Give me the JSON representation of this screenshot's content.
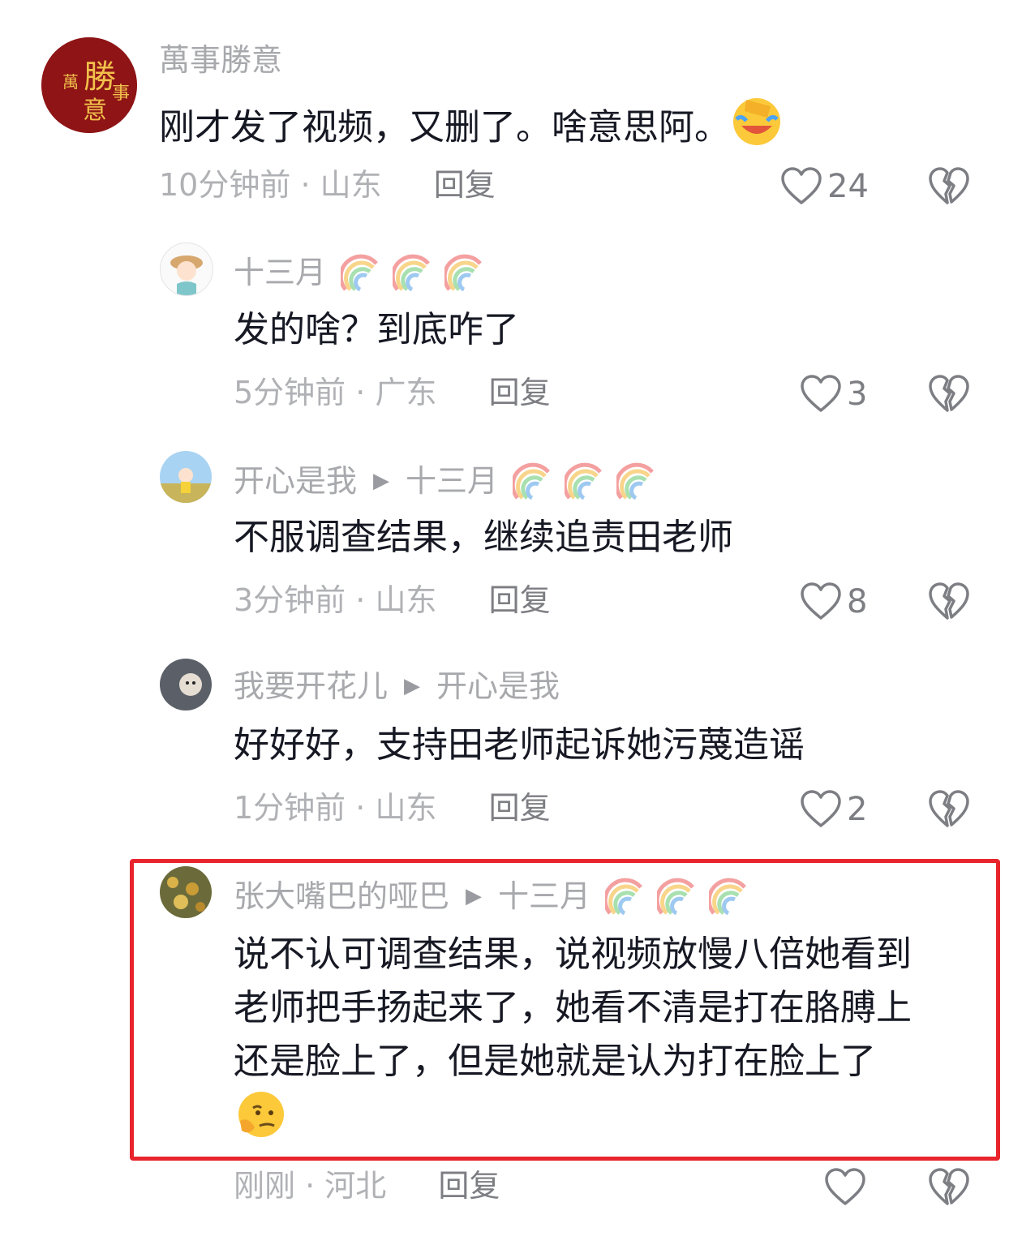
{
  "comments": [
    {
      "user": "萬事勝意",
      "text": "刚才发了视频，又删了。啥意思阿。",
      "time": "10分钟前",
      "location": "山东",
      "reply": "回复",
      "likes": "24",
      "emoji_icon": "face-palm-crying-laugh-icon",
      "avatar_text": "萬勝事意"
    },
    {
      "user": "十三月",
      "badges": [
        "rainbow-icon",
        "rainbow-icon",
        "rainbow-icon"
      ],
      "text": "发的啥？到底咋了",
      "time": "5分钟前",
      "location": "广东",
      "reply": "回复",
      "likes": "3"
    },
    {
      "user": "开心是我",
      "reply_to": "十三月",
      "badges": [
        "rainbow-icon",
        "rainbow-icon",
        "rainbow-icon"
      ],
      "text": "不服调查结果，继续追责田老师",
      "time": "3分钟前",
      "location": "山东",
      "reply": "回复",
      "likes": "8"
    },
    {
      "user": "我要开花儿",
      "reply_to": "开心是我",
      "text": "好好好，支持田老师起诉她污蔑造谣",
      "time": "1分钟前",
      "location": "山东",
      "reply": "回复",
      "likes": "2"
    },
    {
      "user": "张大嘴巴的哑巴",
      "reply_to": "十三月",
      "badges": [
        "rainbow-icon",
        "rainbow-icon",
        "rainbow-icon"
      ],
      "text_lines": [
        "说不认可调查结果，说视频放慢八倍她看到",
        "老师把手扬起来了，她看不清是打在胳膊上",
        "还是脸上了，但是她就是认为打在脸上了"
      ],
      "emoji_icon": "thinking-face-icon",
      "time": "刚刚",
      "location": "河北",
      "reply": "回复",
      "likes": "",
      "highlighted": true
    }
  ],
  "separator": "·",
  "arrow": "▶",
  "colors": {
    "highlight_border": "#e8242d",
    "name_gray": "#a8a9ad",
    "text_dark": "#161823",
    "meta_gray": "#b0b1b5"
  }
}
